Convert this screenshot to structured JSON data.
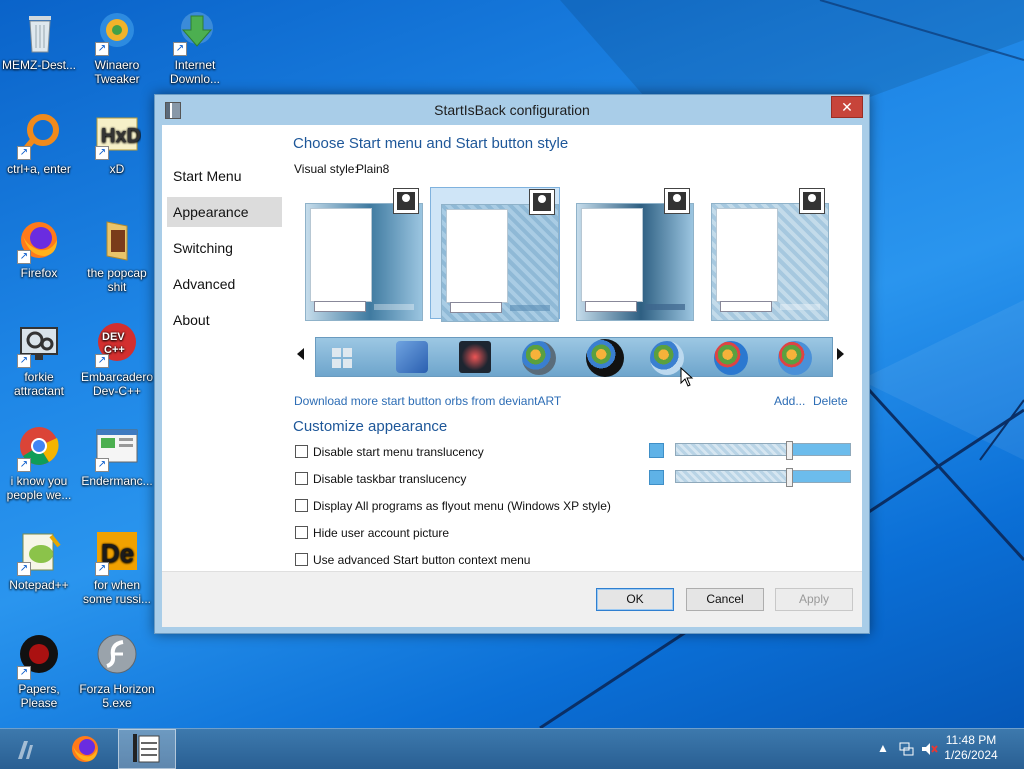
{
  "desktop": {
    "icons": [
      {
        "label": "MEMZ-Dest...",
        "icon": "recycle-bin-icon"
      },
      {
        "label": "Winaero Tweaker",
        "icon": "winaero-tweaker-icon"
      },
      {
        "label": "Internet Downlo...",
        "icon": "internet-download-manager-icon"
      },
      {
        "label": "ctrl+a, enter",
        "icon": "orange-ring-icon"
      },
      {
        "label": "xD",
        "icon": "hxd-icon"
      },
      {
        "label": "Firefox",
        "icon": "firefox-icon"
      },
      {
        "label": "the popcap shit",
        "icon": "folder-icon"
      },
      {
        "label": "forkie attractant",
        "icon": "monitor-settings-icon"
      },
      {
        "label": "Embarcadero Dev-C++",
        "icon": "devcpp-icon"
      },
      {
        "label": "i know you people we...",
        "icon": "chrome-icon"
      },
      {
        "label": "Endermanc...",
        "icon": "window-app-icon"
      },
      {
        "label": "Notepad++",
        "icon": "notepadpp-icon"
      },
      {
        "label": "for when some russi...",
        "icon": "de-app-icon"
      },
      {
        "label": "Papers, Please",
        "icon": "papers-please-icon"
      },
      {
        "label": "Forza Horizon 5.exe",
        "icon": "flash-icon"
      }
    ]
  },
  "window": {
    "title": "StartIsBack configuration",
    "close_glyph": "✕",
    "nav": [
      "Start Menu",
      "Appearance",
      "Switching",
      "Advanced",
      "About"
    ],
    "selected_nav": "Appearance",
    "section1_title": "Choose Start menu and Start button style",
    "visual_style_label": "Visual style:",
    "visual_style_value": "Plain8",
    "download_link": "Download more start button orbs from deviantART",
    "add_link": "Add...",
    "delete_link": "Delete",
    "section2_title": "Customize appearance",
    "options": [
      {
        "label": "Disable start menu translucency",
        "checked": false
      },
      {
        "label": "Disable taskbar translucency",
        "checked": false
      },
      {
        "label": "Display All programs as flyout menu (Windows XP style)",
        "checked": false
      },
      {
        "label": "Hide user account picture",
        "checked": false
      },
      {
        "label": "Use advanced Start button context menu",
        "checked": false
      }
    ],
    "slider_levels": [
      0.65,
      0.65
    ],
    "buttons": {
      "ok": "OK",
      "cancel": "Cancel",
      "apply": "Apply"
    }
  },
  "taskbar": {
    "time": "11:48 PM",
    "date": "1/26/2024"
  },
  "colors": {
    "accent_link": "#2d6db5",
    "heading": "#1e5799",
    "close_red": "#c7443a"
  }
}
